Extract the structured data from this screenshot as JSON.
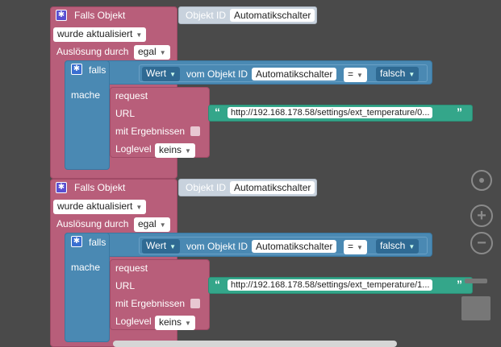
{
  "blocks": [
    {
      "falls_objekt": "Falls Objekt",
      "objekt_id_label": "Objekt ID",
      "objekt_id_value": "Automatikschalter",
      "wurde": "wurde aktualisiert",
      "ausloesung_label": "Auslösung durch",
      "ausloesung_value": "egal",
      "falls": "falls",
      "wert": "Wert",
      "vom_objekt_id": "vom Objekt ID",
      "cond_objekt": "Automatikschalter",
      "op": "=",
      "falsch": "falsch",
      "mache": "mache",
      "request": "request",
      "url_label": "URL",
      "url_value": "http://192.168.178.58/settings/ext_temperature/0...",
      "mit_ergebnissen": "mit Ergebnissen",
      "loglevel_label": "Loglevel",
      "loglevel_value": "keins"
    },
    {
      "falls_objekt": "Falls Objekt",
      "objekt_id_label": "Objekt ID",
      "objekt_id_value": "Automatikschalter",
      "wurde": "wurde aktualisiert",
      "ausloesung_label": "Auslösung durch",
      "ausloesung_value": "egal",
      "falls": "falls",
      "wert": "Wert",
      "vom_objekt_id": "vom Objekt ID",
      "cond_objekt": "Automatikschalter",
      "op": "=",
      "falsch": "falsch",
      "mache": "mache",
      "request": "request",
      "url_label": "URL",
      "url_value": "http://192.168.178.58/settings/ext_temperature/1...",
      "mit_ergebnissen": "mit Ergebnissen",
      "loglevel_label": "Loglevel",
      "loglevel_value": "keins"
    }
  ],
  "icons": {
    "gear": "gear-icon",
    "dropdown": "chevron-down-icon",
    "quote_open": "“",
    "quote_close": "”"
  },
  "controls": [
    "target-icon",
    "zoom-in-icon",
    "zoom-out-icon",
    "trash-icon"
  ]
}
